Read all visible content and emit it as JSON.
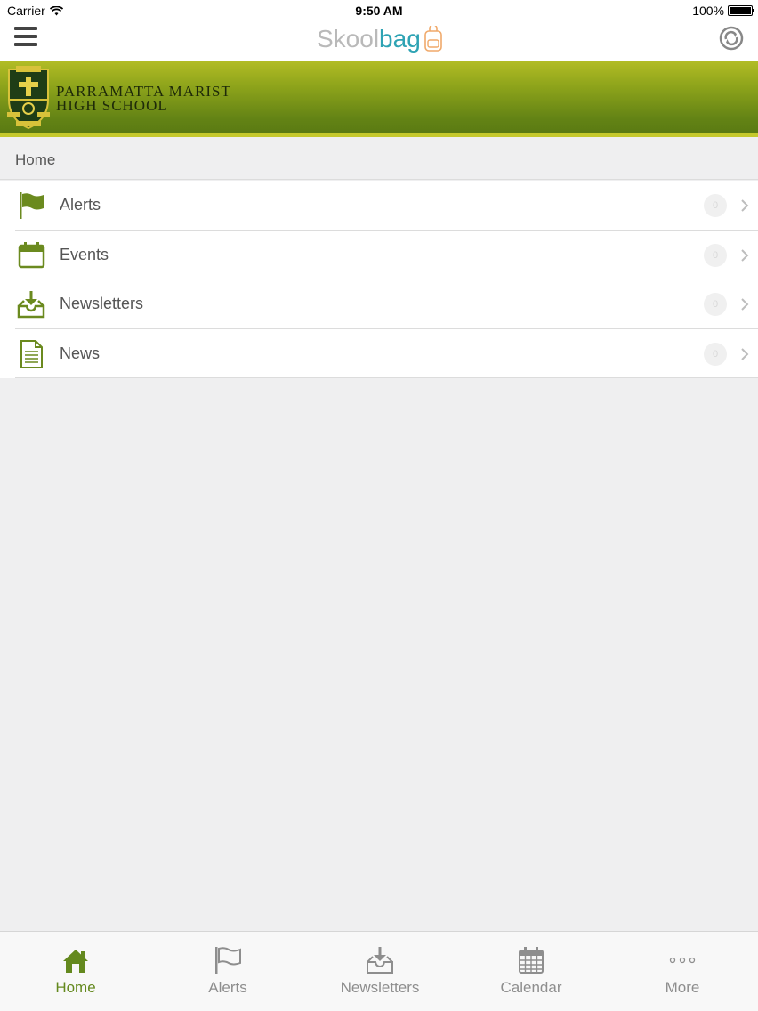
{
  "status_bar": {
    "carrier": "Carrier",
    "time": "9:50 AM",
    "battery": "100%"
  },
  "nav": {
    "logo_part1": "Skool",
    "logo_part2": "bag",
    "menu_icon": "hamburger-icon",
    "sync_icon": "sync-icon"
  },
  "banner": {
    "school_line1": "PARRAMATTA MARIST",
    "school_line2": "HIGH SCHOOL",
    "crest_icon": "school-crest",
    "colors": {
      "top": "#b3bd25",
      "bottom": "#5a7a12",
      "stripe": "#c5c92c"
    }
  },
  "breadcrumb": {
    "label": "Home"
  },
  "list": {
    "items": [
      {
        "label": "Alerts",
        "icon": "flag-icon",
        "badge": "0"
      },
      {
        "label": "Events",
        "icon": "calendar-icon",
        "badge": "0"
      },
      {
        "label": "Newsletters",
        "icon": "inbox-download-icon",
        "badge": "0"
      },
      {
        "label": "News",
        "icon": "document-icon",
        "badge": "0"
      }
    ]
  },
  "tabs": [
    {
      "label": "Home",
      "icon": "home-icon",
      "active": true
    },
    {
      "label": "Alerts",
      "icon": "flag-icon",
      "active": false
    },
    {
      "label": "Newsletters",
      "icon": "inbox-download-icon",
      "active": false
    },
    {
      "label": "Calendar",
      "icon": "calendar-icon",
      "active": false
    },
    {
      "label": "More",
      "icon": "more-icon",
      "active": false
    }
  ],
  "colors": {
    "accent_green": "#64891e",
    "icon_green": "#6b8a1f",
    "logo_gray": "#b9b9b9",
    "logo_teal": "#2ea3b4"
  }
}
